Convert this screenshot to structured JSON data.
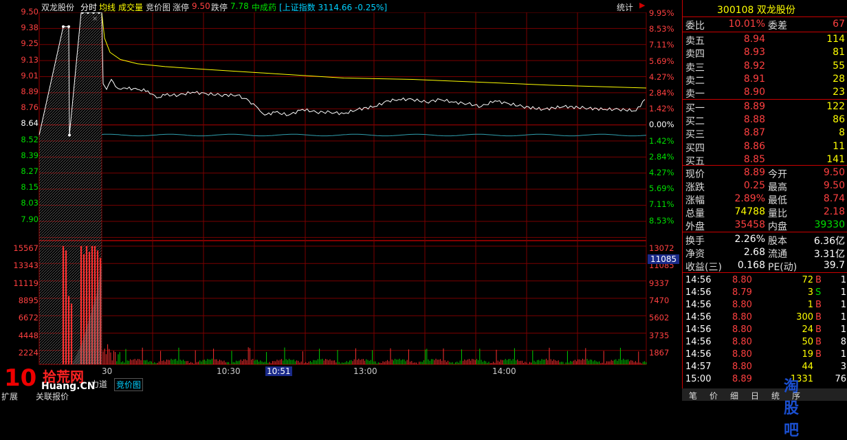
{
  "header": {
    "stock_name": "双龙股份",
    "mode": "分时",
    "avg_line": "均线",
    "volume": "成交量",
    "auction_chart": "竞价图",
    "limit_up_label": "涨停",
    "limit_up_value": "9.50",
    "limit_down_label": "跌停",
    "limit_down_value": "7.78",
    "indicator": "中成药",
    "index_info": "[上证指数 3114.66 -0.25%]",
    "stat": "统计",
    "sidebar_arrow": "▶"
  },
  "axis": {
    "price_left": [
      "9.50",
      "9.38",
      "9.25",
      "9.13",
      "9.01",
      "8.89",
      "8.76",
      "8.64",
      "8.52",
      "8.39",
      "8.27",
      "8.15",
      "8.03",
      "7.90"
    ],
    "pct_right": [
      "9.95%",
      "8.53%",
      "7.11%",
      "5.69%",
      "4.27%",
      "2.84%",
      "1.42%",
      "0.00%",
      "1.42%",
      "2.84%",
      "4.27%",
      "5.69%",
      "7.11%",
      "8.53%"
    ],
    "vol_left": [
      "15567",
      "13343",
      "11119",
      "8895",
      "6672",
      "4448",
      "2224"
    ],
    "vol_right": [
      "13072",
      "11085",
      "9337",
      "7470",
      "5602",
      "3735",
      "1867"
    ],
    "vol_current": "11085",
    "time_labels": [
      "30",
      "10:30",
      "10:51",
      "13:00",
      "14:00"
    ]
  },
  "chart_data": {
    "type": "line",
    "x": [
      "9:15",
      "9:25",
      "9:30",
      "10:00",
      "10:30",
      "11:00",
      "13:00",
      "13:30",
      "14:00",
      "14:30",
      "15:00"
    ],
    "series": [
      {
        "name": "",
        "values": [
          8.64,
          9.5,
          9.5,
          8.95,
          8.97,
          8.8,
          8.84,
          8.83,
          8.83,
          8.8,
          8.89
        ]
      },
      {
        "name": "均线",
        "values": [
          8.64,
          9.5,
          9.5,
          9.13,
          9.09,
          9.06,
          9.03,
          9.01,
          8.99,
          8.97,
          8.96
        ]
      }
    ],
    "ylim": [
      7.9,
      9.5
    ],
    "volume_ylim": [
      0,
      15567
    ]
  },
  "panel": {
    "code": "300108",
    "name": "双龙股份",
    "weibi_label": "委比",
    "weibi_value": "10.01%",
    "weicha_label": "委差",
    "weicha_value": "67",
    "asks": [
      {
        "label": "卖五",
        "price": "8.94",
        "vol": "114"
      },
      {
        "label": "卖四",
        "price": "8.93",
        "vol": "81"
      },
      {
        "label": "卖三",
        "price": "8.92",
        "vol": "55"
      },
      {
        "label": "卖二",
        "price": "8.91",
        "vol": "28"
      },
      {
        "label": "卖一",
        "price": "8.90",
        "vol": "23"
      }
    ],
    "bids": [
      {
        "label": "买一",
        "price": "8.89",
        "vol": "122"
      },
      {
        "label": "买二",
        "price": "8.88",
        "vol": "86"
      },
      {
        "label": "买三",
        "price": "8.87",
        "vol": "8"
      },
      {
        "label": "买四",
        "price": "8.86",
        "vol": "11"
      },
      {
        "label": "买五",
        "price": "8.85",
        "vol": "141"
      }
    ],
    "quote": [
      {
        "l1": "现价",
        "v1": "8.89",
        "l2": "今开",
        "v2": "9.50"
      },
      {
        "l1": "涨跌",
        "v1": "0.25",
        "l2": "最高",
        "v2": "9.50"
      },
      {
        "l1": "涨幅",
        "v1": "2.89%",
        "l2": "最低",
        "v2": "8.74"
      },
      {
        "l1": "总量",
        "v1": "74788",
        "l2": "量比",
        "v2": "2.18"
      },
      {
        "l1": "外盘",
        "v1": "35458",
        "l2": "内盘",
        "v2": "39330"
      }
    ],
    "fund": [
      {
        "l1": "换手",
        "v1": "2.26%",
        "l2": "股本",
        "v2": "6.36亿"
      },
      {
        "l1": "净资",
        "v1": "2.68",
        "l2": "流通",
        "v2": "3.31亿"
      },
      {
        "l1": "收益(三)",
        "v1": "0.168",
        "l2": "PE(动)",
        "v2": "39.7"
      }
    ],
    "ticks": [
      {
        "t": "14:56",
        "p": "8.80",
        "v": "72",
        "s": "B",
        "n": "1"
      },
      {
        "t": "14:56",
        "p": "8.79",
        "v": "3",
        "s": "S",
        "n": "1"
      },
      {
        "t": "14:56",
        "p": "8.80",
        "v": "1",
        "s": "B",
        "n": "1"
      },
      {
        "t": "14:56",
        "p": "8.80",
        "v": "300",
        "s": "B",
        "n": "1"
      },
      {
        "t": "14:56",
        "p": "8.80",
        "v": "24",
        "s": "B",
        "n": "1"
      },
      {
        "t": "14:56",
        "p": "8.80",
        "v": "50",
        "s": "B",
        "n": "8"
      },
      {
        "t": "14:56",
        "p": "8.80",
        "v": "19",
        "s": "B",
        "n": "1"
      },
      {
        "t": "14:57",
        "p": "8.80",
        "v": "44",
        "s": "",
        "n": "3"
      },
      {
        "t": "15:00",
        "p": "8.89",
        "v": "1331",
        "s": "",
        "n": "76"
      }
    ],
    "tabs": [
      "笔",
      "价",
      "细",
      "日",
      "统",
      "序"
    ]
  },
  "bottom": {
    "tab1": "扩展",
    "tab2": "关联报价",
    "tab3": "力道",
    "tab4": "竞价图",
    "watermark1": "10",
    "watermark2": "拾荒网",
    "watermark3": "Huang.CN",
    "watermark4": "淘股吧"
  },
  "colors": {
    "up": "#ff4040",
    "down": "#00e000",
    "grid": "#8a0000",
    "price": "#ffffff",
    "avg": "#ffff00"
  }
}
